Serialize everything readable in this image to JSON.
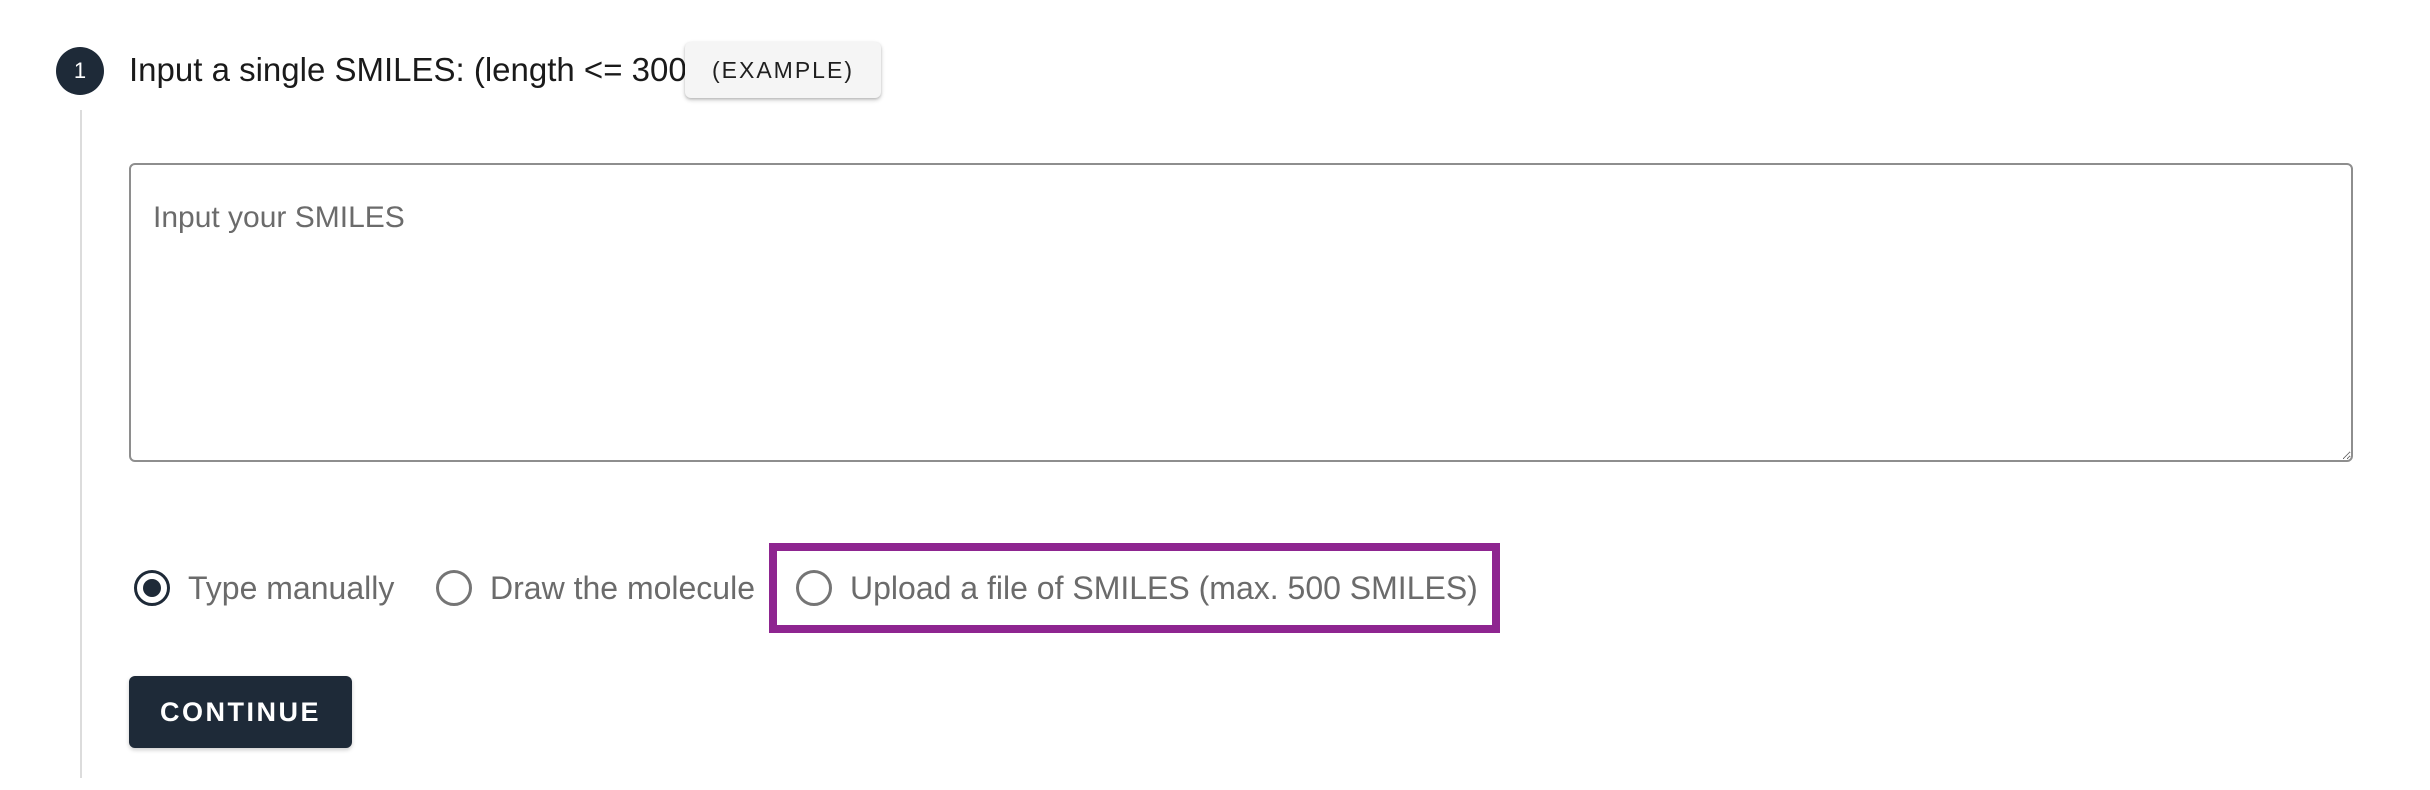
{
  "step": {
    "number": "1",
    "title": "Input a single SMILES: (length <= 300)",
    "example_label": "(EXAMPLE)"
  },
  "smiles_input": {
    "placeholder": "Input your SMILES",
    "value": ""
  },
  "input_mode": {
    "selected": "Type manually",
    "options": [
      {
        "label": "Type manually",
        "checked": true
      },
      {
        "label": "Draw the molecule",
        "checked": false
      },
      {
        "label": "Upload a file of SMILES (max. 500 SMILES)",
        "checked": false
      }
    ]
  },
  "actions": {
    "continue_label": "CONTINUE"
  },
  "colors": {
    "primary": "#1e2a38",
    "highlight": "#8e2590",
    "muted_text": "#6b6b6b"
  },
  "icons": {
    "radio_selected": "radio-checked-icon",
    "radio_unselected": "radio-unchecked-icon"
  }
}
